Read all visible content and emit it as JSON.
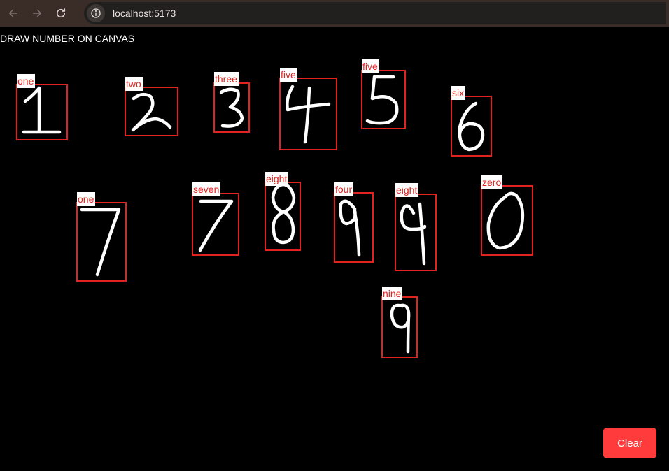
{
  "browser": {
    "url": "localhost:5173",
    "back_icon": "arrow-left-icon",
    "forward_icon": "arrow-right-icon",
    "reload_icon": "reload-icon",
    "info_icon": "info-icon"
  },
  "page": {
    "title": "DRAW NUMBER ON CANVAS",
    "clear_label": "Clear",
    "accent_color": "#e0231f",
    "button_color": "#ff3b3b"
  },
  "detections": [
    {
      "label": "one"
    },
    {
      "label": "two"
    },
    {
      "label": "three"
    },
    {
      "label": "five"
    },
    {
      "label": "five"
    },
    {
      "label": "six"
    },
    {
      "label": "one"
    },
    {
      "label": "seven"
    },
    {
      "label": "eight"
    },
    {
      "label": "four"
    },
    {
      "label": "eight"
    },
    {
      "label": "zero"
    },
    {
      "label": "nine"
    }
  ]
}
